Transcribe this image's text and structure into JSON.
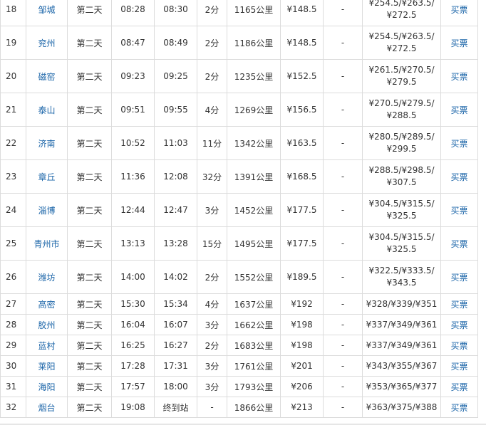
{
  "buy_label": "买票",
  "rows": [
    {
      "no": "18",
      "station": "邹城",
      "day": "第二天",
      "arrive": "08:28",
      "depart": "08:30",
      "stop": "2分",
      "distance": "1165公里",
      "hard_seat": "¥148.5",
      "soft_seat": "-",
      "sleeper_line1": "¥254.5/¥263.5/",
      "sleeper_line2": "¥272.5"
    },
    {
      "no": "19",
      "station": "兖州",
      "day": "第二天",
      "arrive": "08:47",
      "depart": "08:49",
      "stop": "2分",
      "distance": "1186公里",
      "hard_seat": "¥148.5",
      "soft_seat": "-",
      "sleeper_line1": "¥254.5/¥263.5/",
      "sleeper_line2": "¥272.5"
    },
    {
      "no": "20",
      "station": "磁窑",
      "day": "第二天",
      "arrive": "09:23",
      "depart": "09:25",
      "stop": "2分",
      "distance": "1235公里",
      "hard_seat": "¥152.5",
      "soft_seat": "-",
      "sleeper_line1": "¥261.5/¥270.5/",
      "sleeper_line2": "¥279.5"
    },
    {
      "no": "21",
      "station": "泰山",
      "day": "第二天",
      "arrive": "09:51",
      "depart": "09:55",
      "stop": "4分",
      "distance": "1269公里",
      "hard_seat": "¥156.5",
      "soft_seat": "-",
      "sleeper_line1": "¥270.5/¥279.5/",
      "sleeper_line2": "¥288.5"
    },
    {
      "no": "22",
      "station": "济南",
      "day": "第二天",
      "arrive": "10:52",
      "depart": "11:03",
      "stop": "11分",
      "distance": "1342公里",
      "hard_seat": "¥163.5",
      "soft_seat": "-",
      "sleeper_line1": "¥280.5/¥289.5/",
      "sleeper_line2": "¥299.5"
    },
    {
      "no": "23",
      "station": "章丘",
      "day": "第二天",
      "arrive": "11:36",
      "depart": "12:08",
      "stop": "32分",
      "distance": "1391公里",
      "hard_seat": "¥168.5",
      "soft_seat": "-",
      "sleeper_line1": "¥288.5/¥298.5/",
      "sleeper_line2": "¥307.5"
    },
    {
      "no": "24",
      "station": "淄博",
      "day": "第二天",
      "arrive": "12:44",
      "depart": "12:47",
      "stop": "3分",
      "distance": "1452公里",
      "hard_seat": "¥177.5",
      "soft_seat": "-",
      "sleeper_line1": "¥304.5/¥315.5/",
      "sleeper_line2": "¥325.5"
    },
    {
      "no": "25",
      "station": "青州市",
      "day": "第二天",
      "arrive": "13:13",
      "depart": "13:28",
      "stop": "15分",
      "distance": "1495公里",
      "hard_seat": "¥177.5",
      "soft_seat": "-",
      "sleeper_line1": "¥304.5/¥315.5/",
      "sleeper_line2": "¥325.5"
    },
    {
      "no": "26",
      "station": "潍坊",
      "day": "第二天",
      "arrive": "14:00",
      "depart": "14:02",
      "stop": "2分",
      "distance": "1552公里",
      "hard_seat": "¥189.5",
      "soft_seat": "-",
      "sleeper_line1": "¥322.5/¥333.5/",
      "sleeper_line2": "¥343.5"
    },
    {
      "no": "27",
      "station": "高密",
      "day": "第二天",
      "arrive": "15:30",
      "depart": "15:34",
      "stop": "4分",
      "distance": "1637公里",
      "hard_seat": "¥192",
      "soft_seat": "-",
      "sleeper_line1": "¥328/¥339/¥351"
    },
    {
      "no": "28",
      "station": "胶州",
      "day": "第二天",
      "arrive": "16:04",
      "depart": "16:07",
      "stop": "3分",
      "distance": "1662公里",
      "hard_seat": "¥198",
      "soft_seat": "-",
      "sleeper_line1": "¥337/¥349/¥361"
    },
    {
      "no": "29",
      "station": "蓝村",
      "day": "第二天",
      "arrive": "16:25",
      "depart": "16:27",
      "stop": "2分",
      "distance": "1683公里",
      "hard_seat": "¥198",
      "soft_seat": "-",
      "sleeper_line1": "¥337/¥349/¥361"
    },
    {
      "no": "30",
      "station": "莱阳",
      "day": "第二天",
      "arrive": "17:28",
      "depart": "17:31",
      "stop": "3分",
      "distance": "1761公里",
      "hard_seat": "¥201",
      "soft_seat": "-",
      "sleeper_line1": "¥343/¥355/¥367"
    },
    {
      "no": "31",
      "station": "海阳",
      "day": "第二天",
      "arrive": "17:57",
      "depart": "18:00",
      "stop": "3分",
      "distance": "1793公里",
      "hard_seat": "¥206",
      "soft_seat": "-",
      "sleeper_line1": "¥353/¥365/¥377"
    },
    {
      "no": "32",
      "station": "烟台",
      "day": "第二天",
      "arrive": "19:08",
      "depart": "终到站",
      "stop": "-",
      "distance": "1866公里",
      "hard_seat": "¥213",
      "soft_seat": "-",
      "sleeper_line1": "¥363/¥375/¥388"
    }
  ]
}
